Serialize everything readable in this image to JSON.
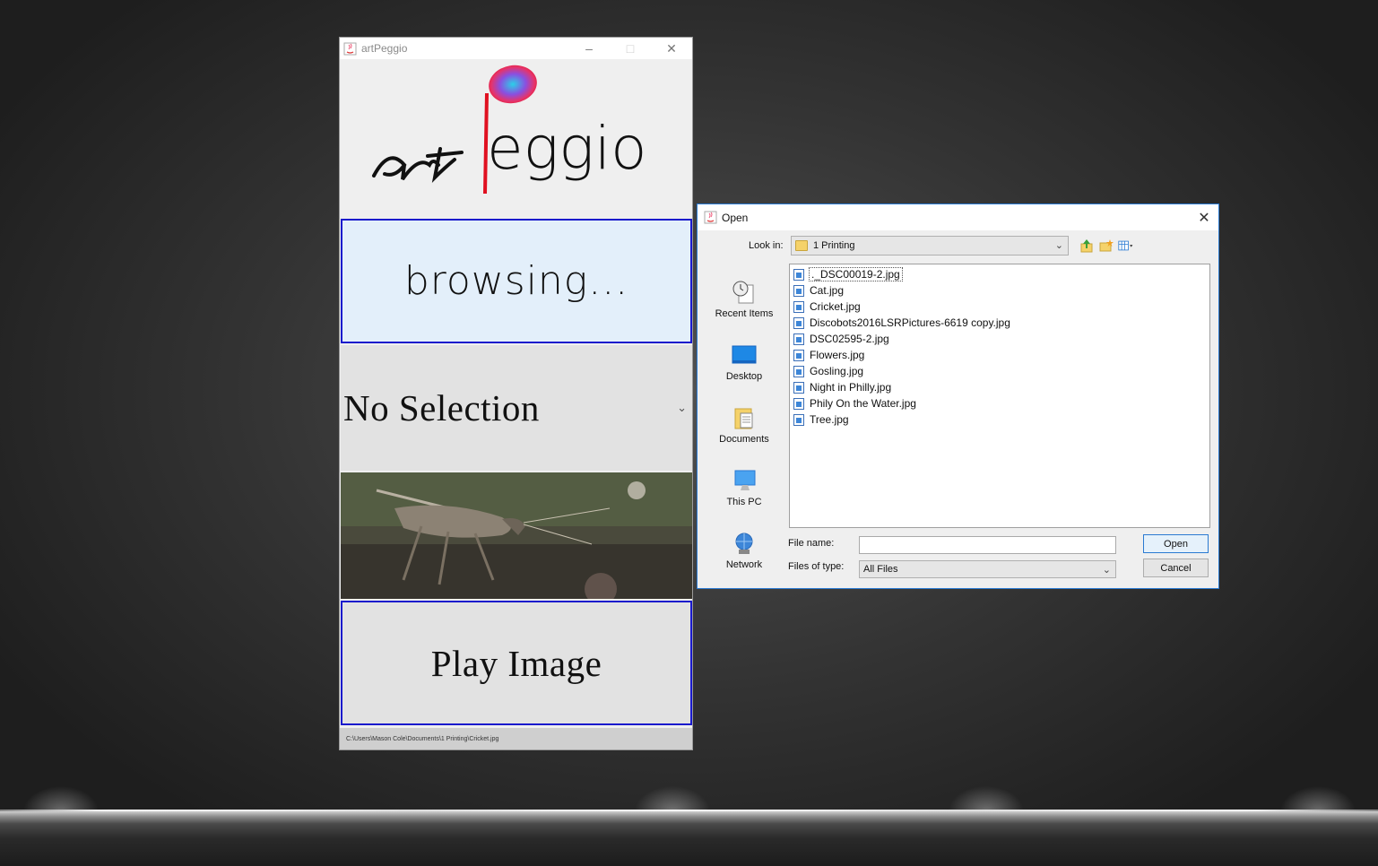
{
  "app": {
    "title": "artPeggio",
    "logo_text": "artPeggio",
    "browse_label": "browsing...",
    "selection_label": "No Selection",
    "play_label": "Play Image",
    "status_path": "C:\\Users\\Mason Cole\\Documents\\1 Printing\\Cricket.jpg",
    "window_controls": [
      "–",
      "□",
      "✕"
    ]
  },
  "dialog": {
    "title": "Open",
    "look_in_label": "Look in:",
    "look_in_value": "1 Printing",
    "places": [
      {
        "label": "Recent Items",
        "icon": "recent-items-icon"
      },
      {
        "label": "Desktop",
        "icon": "desktop-icon"
      },
      {
        "label": "Documents",
        "icon": "documents-icon"
      },
      {
        "label": "This PC",
        "icon": "this-pc-icon"
      },
      {
        "label": "Network",
        "icon": "network-icon"
      }
    ],
    "files": [
      "._DSC00019-2.jpg",
      "Cat.jpg",
      "Cricket.jpg",
      "Discobots2016LSRPictures-6619 copy.jpg",
      "DSC02595-2.jpg",
      "Flowers.jpg",
      "Gosling.jpg",
      "Night in Philly.jpg",
      "Phily On the Water.jpg",
      "Tree.jpg"
    ],
    "file_name_label": "File name:",
    "file_name_value": "",
    "files_of_type_label": "Files of type:",
    "files_of_type_value": "All Files",
    "open_label": "Open",
    "cancel_label": "Cancel",
    "close_glyph": "✕"
  },
  "colors": {
    "button_border": "#1a1acc",
    "dialog_border": "#2a7ad2",
    "browse_bg": "#e3effa"
  }
}
